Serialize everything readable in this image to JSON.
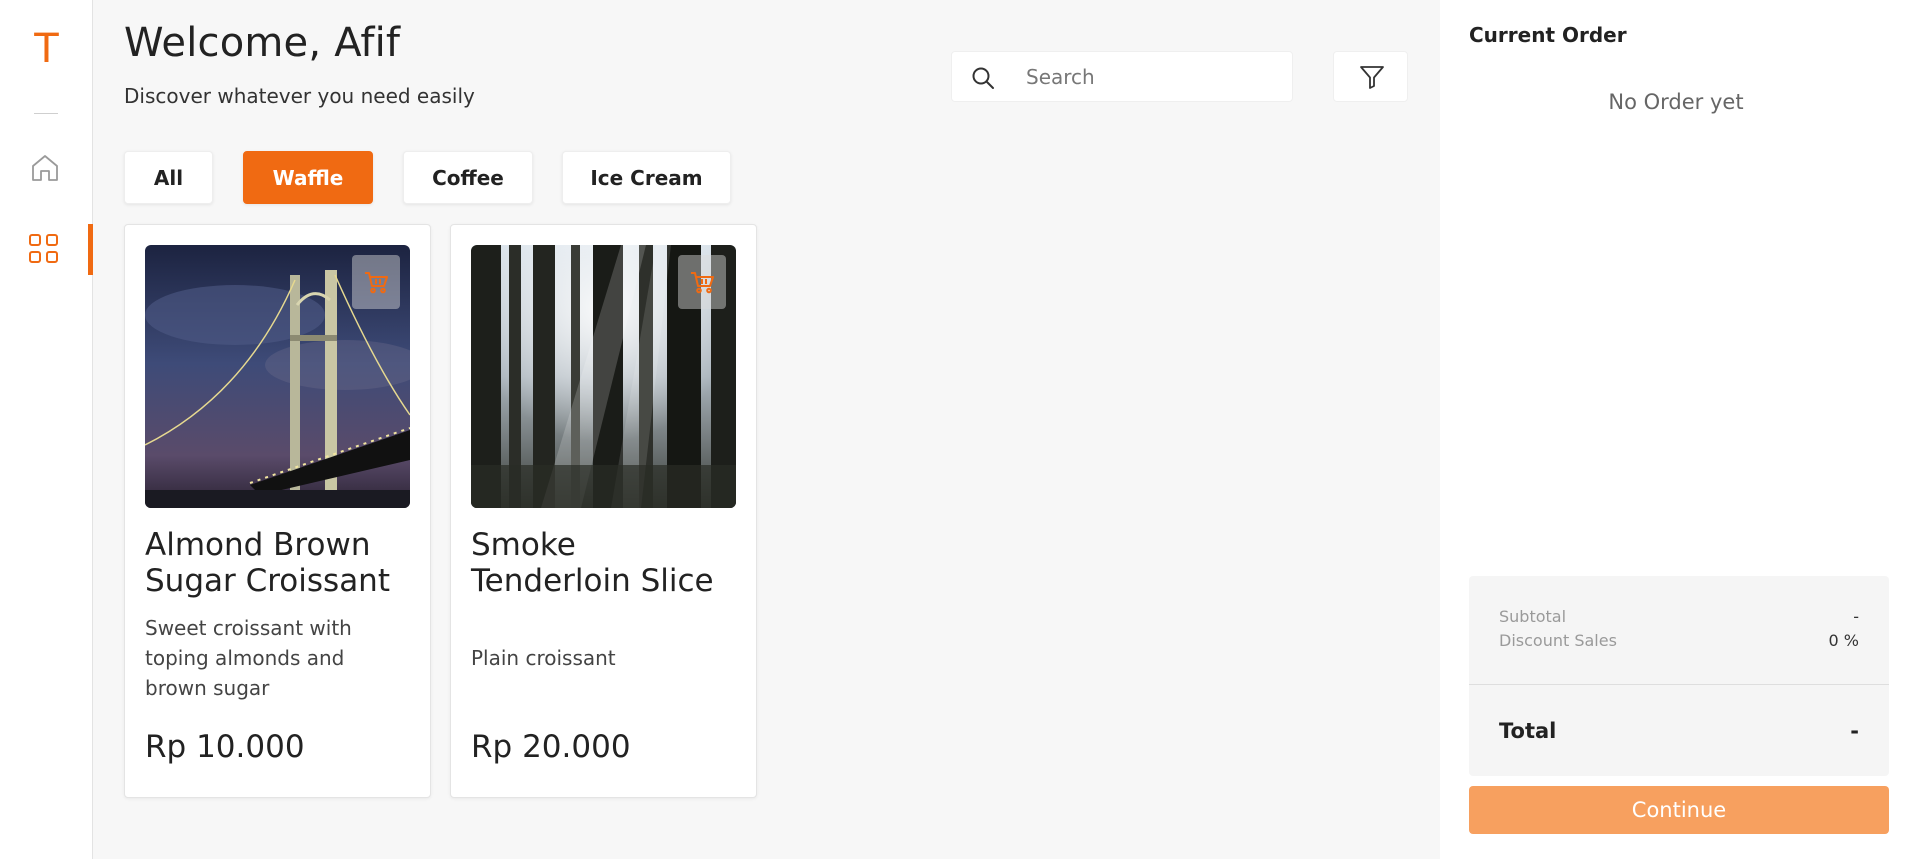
{
  "sidebar": {
    "logo": "T",
    "items": [
      {
        "name": "home",
        "icon": "home-icon",
        "active": false
      },
      {
        "name": "menu",
        "icon": "grid-icon",
        "active": true
      }
    ]
  },
  "header": {
    "welcome": "Welcome, Afif",
    "subtitle": "Discover whatever you need easily"
  },
  "search": {
    "placeholder": "Search",
    "value": ""
  },
  "categories": {
    "items": [
      {
        "label": "All",
        "active": false
      },
      {
        "label": "Waffle",
        "active": true
      },
      {
        "label": "Coffee",
        "active": false
      },
      {
        "label": "Ice Cream",
        "active": false
      }
    ]
  },
  "products": [
    {
      "name": "Almond Brown Sugar Croissant",
      "description": "Sweet croissant with toping almonds and brown sugar",
      "price": "Rp 10.000",
      "image": "bridge-at-night-photo"
    },
    {
      "name": "Smoke Tenderloin Slice",
      "description": "Plain croissant",
      "price": "Rp 20.000",
      "image": "forest-sunlight-photo"
    }
  ],
  "order": {
    "title": "Current Order",
    "empty_text": "No Order yet",
    "subtotal_label": "Subtotal",
    "subtotal_value": "-",
    "discount_label": "Discount Sales",
    "discount_value": "0 %",
    "total_label": "Total",
    "total_value": "-",
    "continue_label": "Continue"
  },
  "colors": {
    "accent": "#f06a12",
    "continue_button": "#f7a05f",
    "background": "#f7f7f7"
  }
}
